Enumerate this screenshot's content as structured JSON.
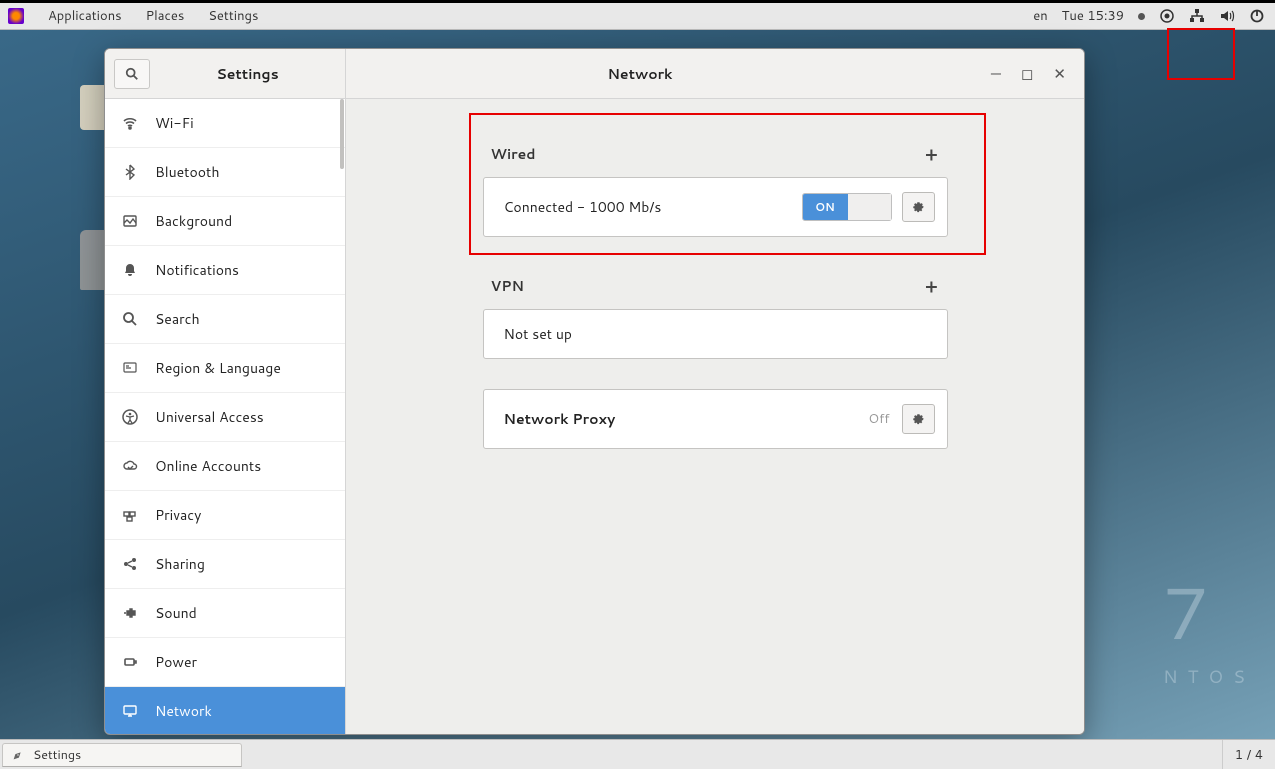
{
  "topbar": {
    "menus": [
      "Applications",
      "Places",
      "Settings"
    ],
    "lang": "en",
    "clock": "Tue 15:39"
  },
  "window": {
    "sidebar_title": "Settings",
    "main_title": "Network"
  },
  "sidebar": {
    "items": [
      {
        "label": "Wi-Fi",
        "icon": "wifi"
      },
      {
        "label": "Bluetooth",
        "icon": "bluetooth"
      },
      {
        "label": "Background",
        "icon": "background"
      },
      {
        "label": "Notifications",
        "icon": "bell"
      },
      {
        "label": "Search",
        "icon": "search"
      },
      {
        "label": "Region & Language",
        "icon": "globe"
      },
      {
        "label": "Universal Access",
        "icon": "accessibility"
      },
      {
        "label": "Online Accounts",
        "icon": "cloud"
      },
      {
        "label": "Privacy",
        "icon": "lock"
      },
      {
        "label": "Sharing",
        "icon": "share"
      },
      {
        "label": "Sound",
        "icon": "sound"
      },
      {
        "label": "Power",
        "icon": "power"
      },
      {
        "label": "Network",
        "icon": "network",
        "selected": true
      }
    ]
  },
  "content": {
    "wired": {
      "title": "Wired",
      "status": "Connected - 1000 Mb/s",
      "switch": "ON"
    },
    "vpn": {
      "title": "VPN",
      "status": "Not set up"
    },
    "proxy": {
      "title": "Network Proxy",
      "status": "Off"
    }
  },
  "taskbar": {
    "app": "Settings",
    "pager": "1 / 4"
  },
  "watermark": {
    "big": "7",
    "small": "NTOS"
  }
}
